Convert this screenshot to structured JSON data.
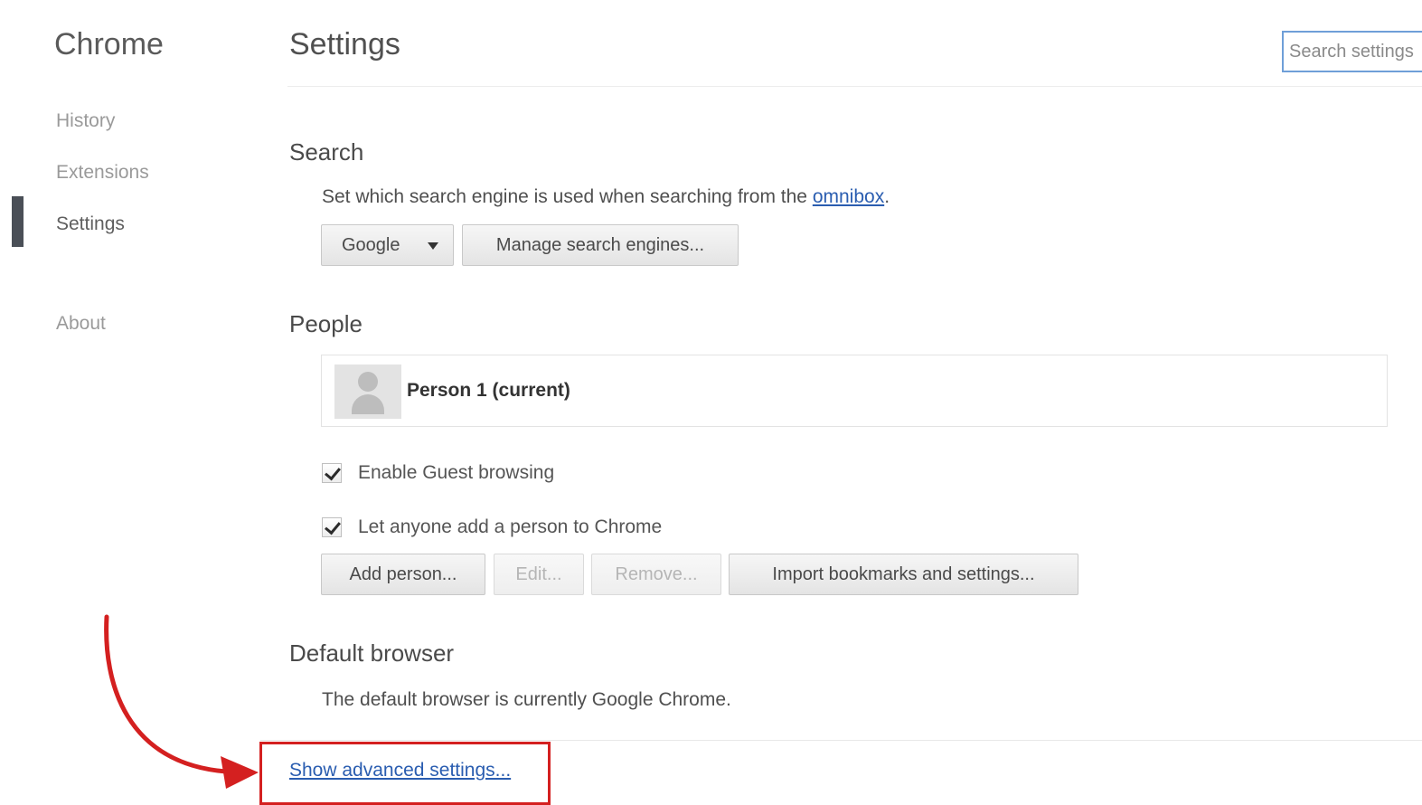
{
  "sidebar": {
    "app_title": "Chrome",
    "items": [
      {
        "label": "History",
        "active": false
      },
      {
        "label": "Extensions",
        "active": false
      },
      {
        "label": "Settings",
        "active": true
      },
      {
        "label": "About",
        "active": false
      }
    ]
  },
  "header": {
    "title": "Settings",
    "search_placeholder": "Search settings"
  },
  "search_section": {
    "title": "Search",
    "description": "Set which search engine is used when searching from the ",
    "omnibox_link": "omnibox",
    "description_end": ".",
    "engine_selected": "Google",
    "manage_button": "Manage search engines..."
  },
  "people_section": {
    "title": "People",
    "person_name": "Person 1 (current)",
    "options": [
      {
        "label": "Enable Guest browsing",
        "checked": true
      },
      {
        "label": "Let anyone add a person to Chrome",
        "checked": true
      }
    ],
    "buttons": {
      "add": "Add person...",
      "edit": "Edit...",
      "remove": "Remove...",
      "import": "Import bookmarks and settings..."
    }
  },
  "default_browser_section": {
    "title": "Default browser",
    "description": "The default browser is currently Google Chrome."
  },
  "footer": {
    "advanced_link": "Show advanced settings..."
  },
  "colors": {
    "link": "#2a5db0",
    "annotation": "#d42020",
    "active_indicator": "#4a4f57"
  }
}
